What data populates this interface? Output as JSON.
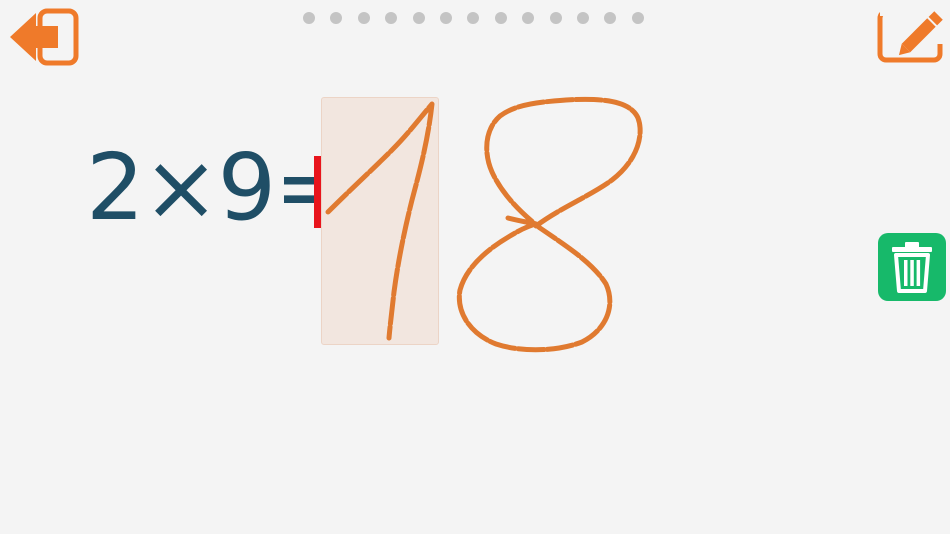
{
  "toolbar": {
    "back_icon": "back-arrow-icon",
    "edit_icon": "pencil-edit-icon"
  },
  "progress": {
    "total": 13,
    "current": 0
  },
  "exercise": {
    "left_operand": "2",
    "operator": "×",
    "right_operand": "9",
    "equals": "=",
    "handwritten_answer": "18"
  },
  "actions": {
    "clear_icon": "trash-icon"
  },
  "colors": {
    "accent": "#ef7a2a",
    "equation_text": "#1f4e66",
    "cursor": "#e8141c",
    "clear_button": "#17b96a",
    "ink": "#e07a30"
  }
}
